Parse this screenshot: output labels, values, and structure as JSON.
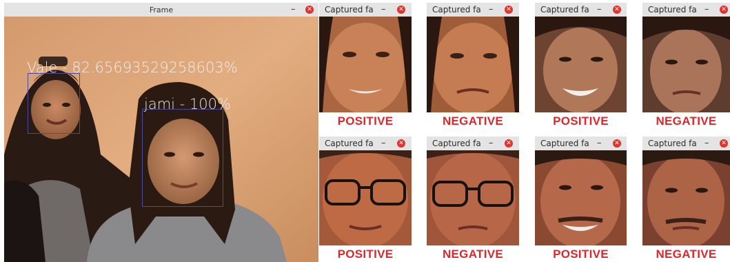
{
  "frame": {
    "title": "Frame",
    "minimize": "–",
    "close": "✕",
    "detections": [
      {
        "text": "Vale - 82.65693529258603%"
      },
      {
        "text": "jami - 100%"
      }
    ]
  },
  "captures": [
    {
      "title": "Captured fa",
      "label": "POSITIVE"
    },
    {
      "title": "Captured fa",
      "label": "NEGATIVE"
    },
    {
      "title": "Captured fa",
      "label": "POSITIVE"
    },
    {
      "title": "Captured fa",
      "label": "NEGATIVE"
    },
    {
      "title": "Captured fa",
      "label": "POSITIVE"
    },
    {
      "title": "Captured fa",
      "label": "NEGATIVE"
    },
    {
      "title": "Captured fa",
      "label": "POSITIVE"
    },
    {
      "title": "Captured fa",
      "label": "NEGATIVE"
    }
  ],
  "window_controls": {
    "minimize": "–",
    "close": "✕"
  }
}
